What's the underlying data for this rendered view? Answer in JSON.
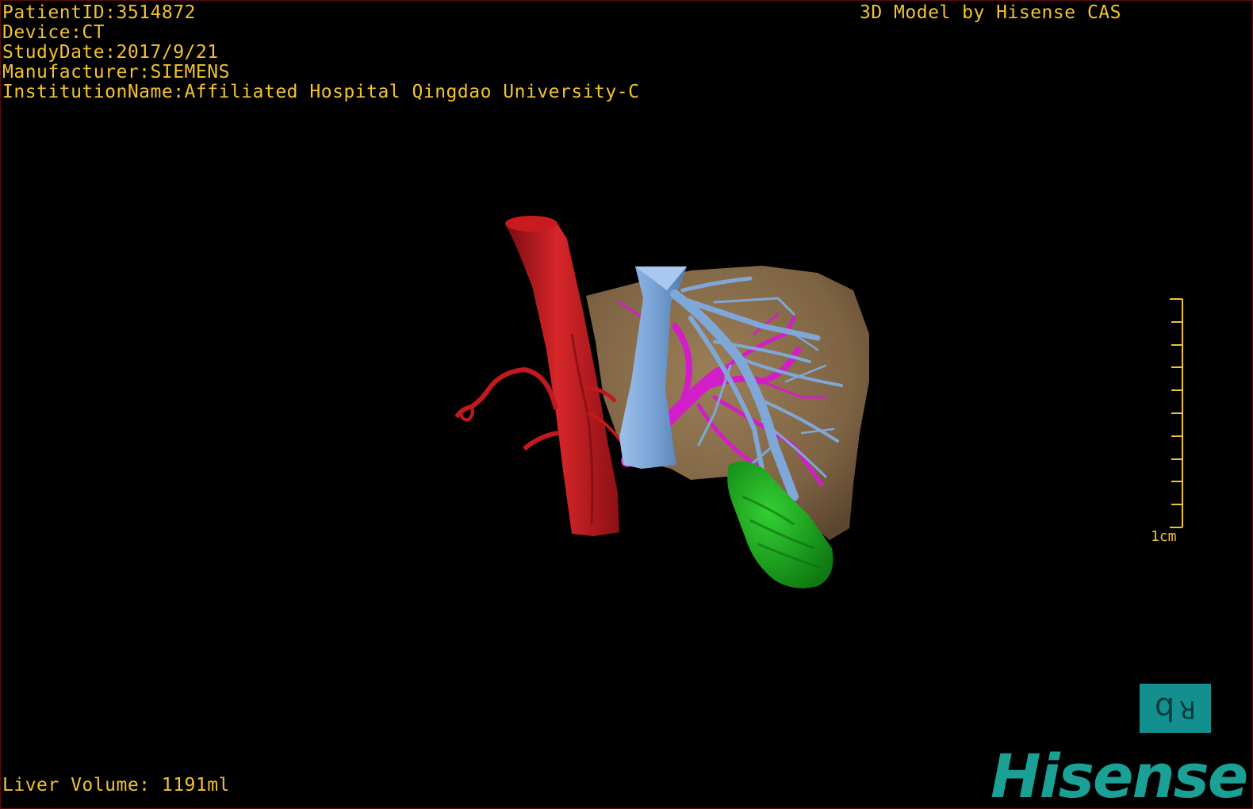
{
  "header": {
    "patient_id": "PatientID:3514872",
    "device": "Device:CT",
    "study_date": "StudyDate:2017/9/21",
    "manufacturer": "Manufacturer:SIEMENS",
    "institution": "InstitutionName:Affiliated Hospital Qingdao University-C",
    "model_credit": "3D Model by Hisense CAS"
  },
  "footer": {
    "liver_volume": "Liver Volume: 1191ml"
  },
  "scale_bar": {
    "label": "1cm"
  },
  "orientation_cube": {
    "front_glyph": "d",
    "side_glyph": "R"
  },
  "brand": {
    "logo_text": "Hisense"
  },
  "colors": {
    "overlay_text": "#f2c232",
    "aorta": "#c0191e",
    "vena_cava": "#7fa8d8",
    "portal_vein": "#d21ec8",
    "liver": "#8a6e4b",
    "gallbladder": "#1aa51a",
    "brand": "#1aa095"
  }
}
